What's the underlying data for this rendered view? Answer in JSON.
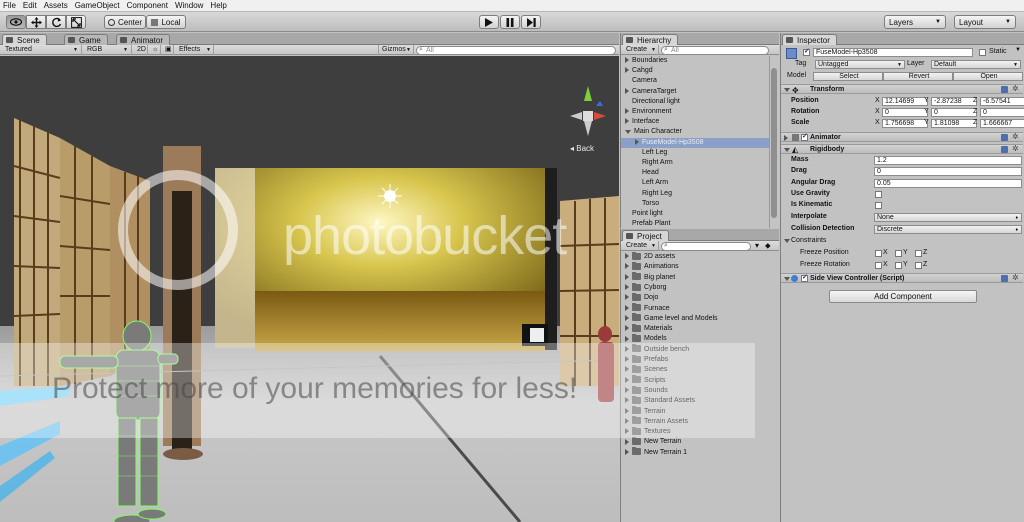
{
  "menu": [
    "File",
    "Edit",
    "Assets",
    "GameObject",
    "Component",
    "Window",
    "Help"
  ],
  "toolbar": {
    "pivot_label": "Center",
    "space_label": "Local",
    "layers_label": "Layers",
    "layout_label": "Layout"
  },
  "scene": {
    "tabs": [
      "Scene",
      "Game",
      "Animator"
    ],
    "shading_mode": "Textured",
    "render_mode": "RGB",
    "mode_2d": "2D",
    "effects_label": "Effects",
    "gizmos_label": "Gizmos",
    "search_placeholder": "All",
    "back_label": "Back"
  },
  "hierarchy": {
    "tab_label": "Hierarchy",
    "create_label": "Create",
    "search_placeholder": "All",
    "items": [
      {
        "label": "Boundaries",
        "depth": 0,
        "arrow": "closed"
      },
      {
        "label": "Cahgd",
        "depth": 0,
        "arrow": "closed"
      },
      {
        "label": "Camera",
        "depth": 0,
        "arrow": "none"
      },
      {
        "label": "CameraTarget",
        "depth": 0,
        "arrow": "closed"
      },
      {
        "label": "Directional light",
        "depth": 0,
        "arrow": "none"
      },
      {
        "label": "Environment",
        "depth": 0,
        "arrow": "closed"
      },
      {
        "label": "Interface",
        "depth": 0,
        "arrow": "closed"
      },
      {
        "label": "Main Character",
        "depth": 0,
        "arrow": "open"
      },
      {
        "label": "FuseModel-Hp3508",
        "depth": 1,
        "arrow": "closed",
        "selected": true
      },
      {
        "label": "Left Leg",
        "depth": 1,
        "arrow": "none"
      },
      {
        "label": "Right Arm",
        "depth": 1,
        "arrow": "none"
      },
      {
        "label": "Head",
        "depth": 1,
        "arrow": "none"
      },
      {
        "label": "Left Arm",
        "depth": 1,
        "arrow": "none"
      },
      {
        "label": "Right Leg",
        "depth": 1,
        "arrow": "none"
      },
      {
        "label": "Torso",
        "depth": 1,
        "arrow": "none"
      },
      {
        "label": "Point light",
        "depth": 0,
        "arrow": "none"
      },
      {
        "label": "Prefab Plant",
        "depth": 0,
        "arrow": "none"
      }
    ]
  },
  "project": {
    "tab_label": "Project",
    "create_label": "Create",
    "folders": [
      "2D assets",
      "Animations",
      "Big planet",
      "Cyborg",
      "Dojo",
      "Furnace",
      "Game level and Models",
      "Materials",
      "Models",
      "Outside bench",
      "Prefabs",
      "Scenes",
      "Scripts",
      "Sounds",
      "Standard Assets",
      "Terrain",
      "Terrain Assets",
      "Textures",
      "New Terrain",
      "New Terrain 1"
    ]
  },
  "inspector": {
    "tab_label": "Inspector",
    "object_name": "FuseModel-Hp3508",
    "static_label": "Static",
    "tag_label": "Tag",
    "tag_value": "Untagged",
    "layer_label": "Layer",
    "layer_value": "Default",
    "model_label": "Model",
    "select_btn": "Select",
    "revert_btn": "Revert",
    "open_btn": "Open",
    "transform": {
      "title": "Transform",
      "position_label": "Position",
      "rotation_label": "Rotation",
      "scale_label": "Scale",
      "position": [
        "12.14699",
        "-2.87238",
        "-6.57541"
      ],
      "rotation": [
        "0",
        "0",
        "0"
      ],
      "scale": [
        "1.756698",
        "1.81098",
        "1.666667"
      ]
    },
    "animator_title": "Animator",
    "rigidbody": {
      "title": "Rigidbody",
      "mass_label": "Mass",
      "mass": "1.2",
      "drag_label": "Drag",
      "drag": "0",
      "angular_drag_label": "Angular Drag",
      "angular_drag": "0.05",
      "use_gravity_label": "Use Gravity",
      "is_kinematic_label": "Is Kinematic",
      "interpolate_label": "Interpolate",
      "interpolate": "None",
      "collision_label": "Collision Detection",
      "collision": "Discrete",
      "constraints_label": "Constraints",
      "freeze_position_label": "Freeze Position",
      "freeze_rotation_label": "Freeze Rotation",
      "axes": [
        "X",
        "Y",
        "Z"
      ]
    },
    "script_title": "Side View Controller (Script)",
    "add_component": "Add Component"
  },
  "watermark": {
    "brand": "photobucket",
    "tagline": "Protect more of your memories for less!"
  }
}
